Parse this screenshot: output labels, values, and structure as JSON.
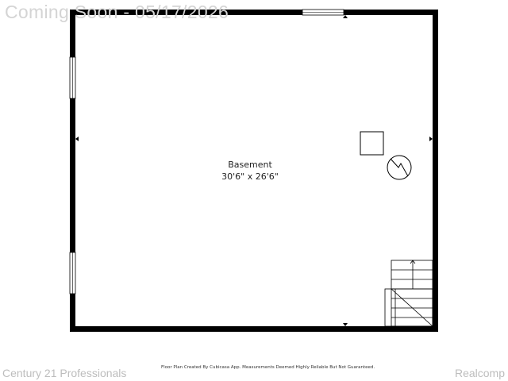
{
  "watermark": {
    "top": "Coming Soon - 05/17/2026",
    "bottom_left": "Century 21 Professionals",
    "bottom_right": "Realcomp"
  },
  "room": {
    "name": "Basement",
    "dimensions": "30'6\" x 26'6\""
  },
  "footer": {
    "note": "Floor Plan Created By Cubicasa App. Measurements Deemed Highly Reliable But Not Guaranteed."
  },
  "colors": {
    "wall": "#000000",
    "watermark": "#d4d4d4",
    "background": "#ffffff"
  },
  "icons": [
    "window",
    "water-heater-icon",
    "stairs-icon",
    "wall-marker-arrow"
  ]
}
